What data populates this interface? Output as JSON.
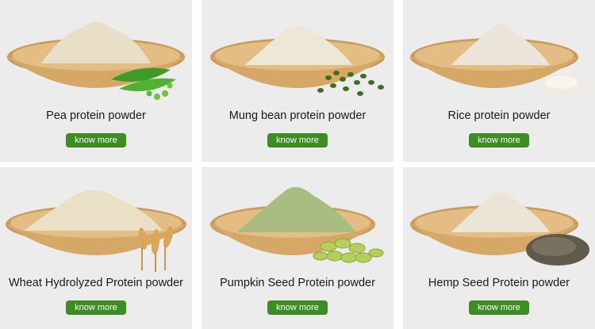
{
  "products": [
    {
      "name": "Pea protein powder",
      "button": "know more",
      "powder_color": "#e9dfc8",
      "ingredient": "pea-pods-icon"
    },
    {
      "name": "Mung bean protein powder",
      "button": "know more",
      "powder_color": "#ede8d6",
      "ingredient": "mung-beans-icon"
    },
    {
      "name": "Rice protein powder",
      "button": "know more",
      "powder_color": "#ece6da",
      "ingredient": "rice-grains-icon"
    },
    {
      "name": "Wheat Hydrolyzed Protein powder",
      "button": "know more",
      "powder_color": "#ebdfc6",
      "ingredient": "wheat-ears-icon"
    },
    {
      "name": "Pumpkin Seed Protein powder",
      "button": "know more",
      "powder_color": "#a9bd83",
      "ingredient": "pumpkin-seeds-icon"
    },
    {
      "name": "Hemp Seed Protein powder",
      "button": "know more",
      "powder_color": "#ebe5d6",
      "ingredient": "hemp-seeds-icon"
    }
  ],
  "colors": {
    "card_bg": "#ececec",
    "button_bg": "#3d8d22",
    "button_text": "#ffffff",
    "bowl": "#d9ad6e"
  }
}
